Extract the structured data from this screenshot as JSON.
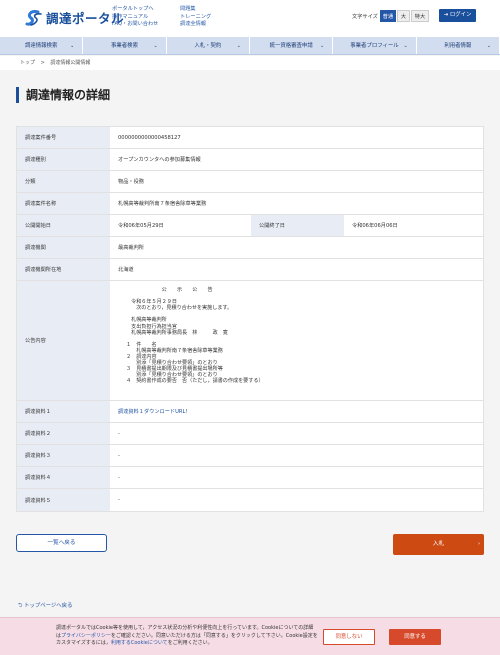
{
  "header": {
    "logo_text": "調達ポータル",
    "links_col1": [
      "ポータルトップへ",
      "操作マニュアル",
      "FAQ・お問い合わせ"
    ],
    "links_col2": [
      "問題集",
      "トレーニング",
      "調達全情報"
    ],
    "font_size_label": "文字サイズ",
    "font_sizes": [
      "普通",
      "大",
      "特大"
    ],
    "login_label": "ログイン"
  },
  "nav": {
    "items": [
      "調達情報検索",
      "事業者検索",
      "入札・契約",
      "統一資格審査申請",
      "事業者プロフィール",
      "利用者情報"
    ]
  },
  "breadcrumb": [
    "トップ",
    ">",
    "調達情報公開情報"
  ],
  "page_title": "調達情報の詳細",
  "details": {
    "case_number_label": "調達案件番号",
    "case_number": "0000000000000458127",
    "type_label": "調達種別",
    "type": "オープンカウンタへの参加募集情報",
    "category_label": "分類",
    "category": "物品・役務",
    "name_label": "調達案件名称",
    "name": "札幌高等裁判所南７条宿舎除草等業務",
    "start_label": "公開開始日",
    "start": "令和06年05月29日",
    "end_label": "公開終了日",
    "end": "令和06年06月06日",
    "org_label": "調達機関",
    "org": "最高裁判所",
    "location_label": "調達機関所在地",
    "location": "北海道",
    "notice_label": "公告内容",
    "notice": "　　　　　　　公　　示　　公　　告\n\n　令和６年５月２９日\n　　次のとおり，見積り合わせを実施します。\n\n　札幌高等裁判所\n　支出負担行為担当官\n　札幌高等裁判所事務局長　林　　　政　寛\n\n１　件　　名\n　　札幌高等裁判所南７条宿舎除草等業務\n２　調達内容\n　　別添「見積り合わせ要領」のとおり\n３　見積書提出期限及び見積書提出場所等\n　　別添「見積り合わせ要領」のとおり\n４　契約書作成の要否　否（ただし，請書の作成を要する）",
    "docs": [
      {
        "label": "調達資料１",
        "value": "調達資料１ダウンロードURL！"
      },
      {
        "label": "調達資料２",
        "value": "-"
      },
      {
        "label": "調達資料３",
        "value": "-"
      },
      {
        "label": "調達資料４",
        "value": "-"
      },
      {
        "label": "調達資料５",
        "value": "-"
      }
    ]
  },
  "buttons": {
    "back": "一覧へ戻る",
    "bid": "入札"
  },
  "top_link": "トップページへ戻る",
  "cookie": {
    "text_a": "調達ポータルではCookie等を使用して，アクセス状況の分析や利便性向上を行っています。Cookieについての詳細は",
    "policy_link": "プライバシーポリシー",
    "text_b": "をご確認ください。同意いただける方は「同意する」をクリックして下さい。Cookie設定をカスタマイズするには，",
    "settings_link": "利用するCookieについて",
    "text_c": "をご利用ください。",
    "decline": "同意しない",
    "accept": "同意する"
  },
  "colors": {
    "brand": "#1a4f9c",
    "bid": "#cd4a13",
    "nav_bg": "#d2ddef"
  }
}
